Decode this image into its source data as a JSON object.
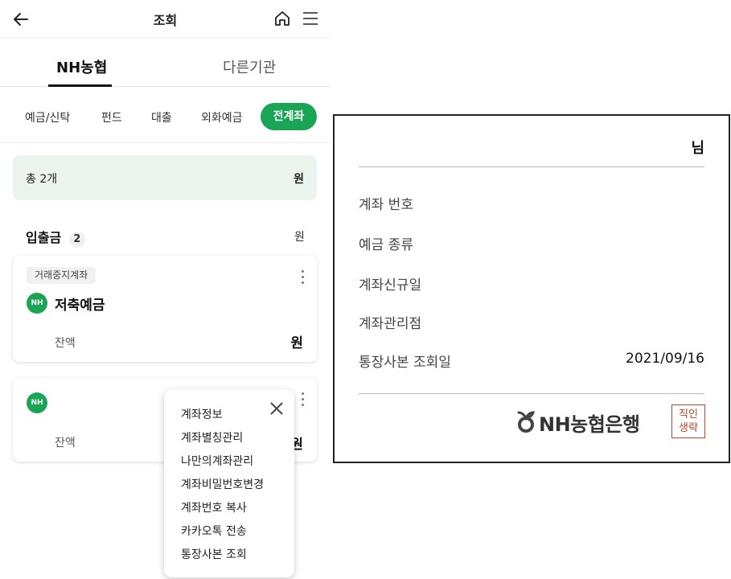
{
  "header": {
    "title": "조회",
    "back_icon": "arrow-left-icon",
    "home_icon": "home-icon",
    "menu_icon": "hamburger-menu-icon"
  },
  "institution_tabs": [
    {
      "label": "NH농협",
      "selected": true
    },
    {
      "label": "다른기관",
      "selected": false
    }
  ],
  "categories": [
    {
      "label": "예금/신탁",
      "selected": false
    },
    {
      "label": "펀드",
      "selected": false
    },
    {
      "label": "대출",
      "selected": false
    },
    {
      "label": "외화예금",
      "selected": false
    },
    {
      "label": "전계좌",
      "selected": true
    }
  ],
  "summary": {
    "label": "총 2개",
    "unit": "원"
  },
  "section": {
    "title": "입출금",
    "count": "2",
    "unit": "원"
  },
  "accounts": [
    {
      "badge": "거래중지계좌",
      "logo": "NH",
      "name": "저축예금",
      "balance_label": "잔액",
      "balance_unit": "원"
    },
    {
      "logo": "NH",
      "balance_label": "잔액",
      "balance_unit": "원"
    }
  ],
  "popup_menu": {
    "items": [
      "계좌정보",
      "계좌별칭관리",
      "나만의계좌관리",
      "계좌비밀번호변경",
      "계좌번호 복사",
      "카카오톡 전송",
      "통장사본 조회"
    ]
  },
  "passbook": {
    "name_suffix": "님",
    "rows": [
      {
        "label": "계좌 번호",
        "value": ""
      },
      {
        "label": "예금 종류",
        "value": ""
      },
      {
        "label": "계좌신규일",
        "value": ""
      },
      {
        "label": "계좌관리점",
        "value": ""
      },
      {
        "label": "통장사본 조회일",
        "value": "2021/09/16"
      }
    ],
    "brand": "NH농협은행",
    "stamp": [
      "직인",
      "생략"
    ]
  },
  "colors": {
    "accent": "#1aa556",
    "summary_bg": "#ebf5ee",
    "stamp": "#c0472b"
  }
}
